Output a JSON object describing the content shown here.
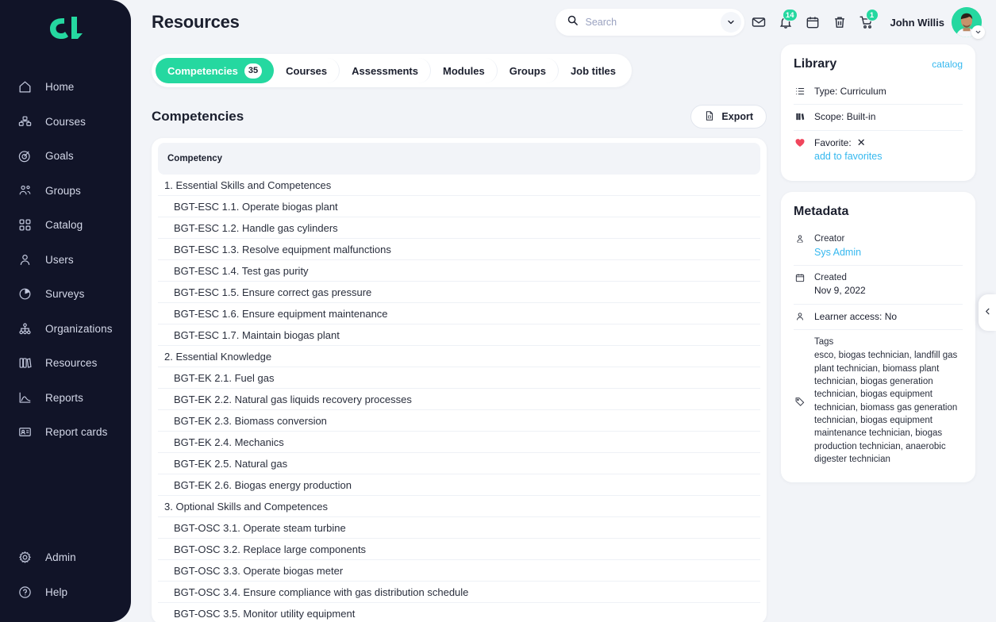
{
  "brand": {
    "logo_name": "cl-logo",
    "accent": "#25d8a0",
    "sidebar_bg": "#111428",
    "page_bg": "#f2f4f8",
    "link_blue": "#35b8ef"
  },
  "sidebar": {
    "items": [
      {
        "label": "Home",
        "icon": "home-icon"
      },
      {
        "label": "Courses",
        "icon": "courses-blocks-icon"
      },
      {
        "label": "Goals",
        "icon": "goals-target-icon"
      },
      {
        "label": "Groups",
        "icon": "groups-people-icon"
      },
      {
        "label": "Catalog",
        "icon": "catalog-grid-icon"
      },
      {
        "label": "Users",
        "icon": "user-icon"
      },
      {
        "label": "Surveys",
        "icon": "surveys-pie-icon"
      },
      {
        "label": "Organizations",
        "icon": "organizations-hierarchy-icon"
      },
      {
        "label": "Resources",
        "icon": "resources-books-icon"
      },
      {
        "label": "Reports",
        "icon": "reports-chart-icon"
      },
      {
        "label": "Report cards",
        "icon": "report-cards-id-icon"
      }
    ],
    "bottom_items": [
      {
        "label": "Admin",
        "icon": "gear-icon"
      },
      {
        "label": "Help",
        "icon": "question-circle-icon"
      }
    ]
  },
  "header": {
    "title": "Resources",
    "search": {
      "placeholder": "Search",
      "value": "",
      "icon": "search-icon",
      "chevron": "chevron-down-icon"
    },
    "icons": [
      {
        "name": "mail-icon",
        "badge": ""
      },
      {
        "name": "bell-icon",
        "badge": "14"
      },
      {
        "name": "calendar-icon",
        "badge": ""
      },
      {
        "name": "trash-icon",
        "badge": ""
      },
      {
        "name": "cart-icon",
        "badge": "1"
      }
    ],
    "user": {
      "name": "John Willis",
      "avatar": "avatar",
      "chevron": "chevron-down-icon"
    }
  },
  "tabs": [
    {
      "label": "Competencies",
      "count": "35",
      "active": true
    },
    {
      "label": "Courses",
      "count": "",
      "active": false
    },
    {
      "label": "Assessments",
      "count": "",
      "active": false
    },
    {
      "label": "Modules",
      "count": "",
      "active": false
    },
    {
      "label": "Groups",
      "count": "",
      "active": false
    },
    {
      "label": "Job titles",
      "count": "",
      "active": false
    }
  ],
  "section": {
    "title": "Competencies",
    "export_label": "Export",
    "export_icon": "file-export-icon"
  },
  "table": {
    "column_header": "Competency",
    "rows": [
      {
        "text": "1. Essential Skills and Competences",
        "type": "group"
      },
      {
        "text": "BGT-ESC 1.1. Operate biogas plant",
        "type": "child"
      },
      {
        "text": "BGT-ESC 1.2. Handle gas cylinders",
        "type": "child"
      },
      {
        "text": "BGT-ESC 1.3. Resolve equipment malfunctions",
        "type": "child"
      },
      {
        "text": "BGT-ESC 1.4. Test gas purity",
        "type": "child"
      },
      {
        "text": "BGT-ESC 1.5. Ensure correct gas pressure",
        "type": "child"
      },
      {
        "text": "BGT-ESC 1.6. Ensure equipment maintenance",
        "type": "child"
      },
      {
        "text": "BGT-ESC 1.7. Maintain biogas plant",
        "type": "child"
      },
      {
        "text": "2. Essential Knowledge",
        "type": "group"
      },
      {
        "text": "BGT-EK 2.1. Fuel gas",
        "type": "child"
      },
      {
        "text": "BGT-EK 2.2. Natural gas liquids recovery processes",
        "type": "child"
      },
      {
        "text": "BGT-EK 2.3. Biomass conversion",
        "type": "child"
      },
      {
        "text": "BGT-EK 2.4. Mechanics",
        "type": "child"
      },
      {
        "text": "BGT-EK 2.5. Natural gas",
        "type": "child"
      },
      {
        "text": "BGT-EK 2.6. Biogas energy production",
        "type": "child"
      },
      {
        "text": "3. Optional Skills and Competences",
        "type": "group"
      },
      {
        "text": "BGT-OSC 3.1. Operate steam turbine",
        "type": "child"
      },
      {
        "text": "BGT-OSC 3.2. Replace large components",
        "type": "child"
      },
      {
        "text": "BGT-OSC 3.3. Operate biogas meter",
        "type": "child"
      },
      {
        "text": "BGT-OSC 3.4. Ensure compliance with gas distribution schedule",
        "type": "child"
      },
      {
        "text": "BGT-OSC 3.5. Monitor utility equipment",
        "type": "child"
      }
    ]
  },
  "library": {
    "title": "Library",
    "link": "catalog",
    "type_row": {
      "icon": "list-icon",
      "text": "Type: Curriculum"
    },
    "scope_row": {
      "icon": "books-icon",
      "text": "Scope: Built-in"
    },
    "favorite_row": {
      "icon": "heart-icon",
      "label": "Favorite:",
      "value": "✕",
      "action": "add to favorites"
    }
  },
  "metadata": {
    "title": "Metadata",
    "creator": {
      "icon": "creator-icon",
      "label": "Creator",
      "value": "Sys Admin"
    },
    "created": {
      "icon": "calendar-icon",
      "label": "Created",
      "value": "Nov 9, 2022"
    },
    "learner_access": {
      "icon": "user-icon",
      "text": "Learner access: No"
    },
    "tags": {
      "icon": "tag-icon",
      "label": "Tags",
      "value": "esco, biogas technician, landfill gas plant technician, biomass plant technician, biogas generation technician, biogas equipment technician, biomass gas generation technician, biogas equipment maintenance technician, biogas production technician, anaerobic digester technician"
    }
  },
  "collapse": {
    "icon": "chevron-left-icon"
  }
}
